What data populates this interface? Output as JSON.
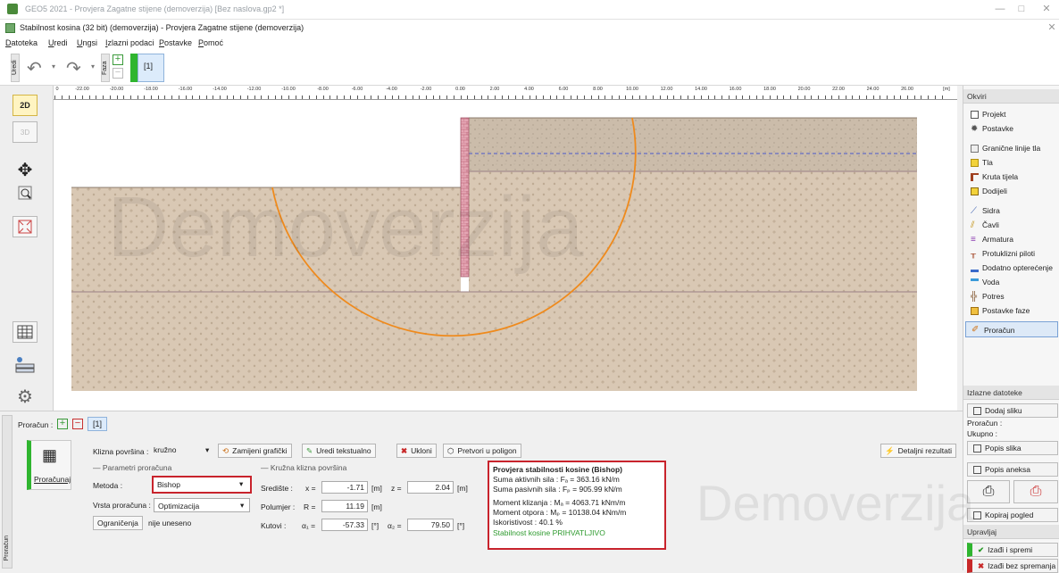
{
  "window": {
    "title": "GEO5 2021 - Provjera Zagatne stijene (demoverzija) [Bez naslova.gp2 *]",
    "subtitle": "Stabilnost kosina (32 bit) (demoverzija) - Provjera Zagatne stijene (demoverzija)",
    "min": "—",
    "max": "□",
    "close": "✕",
    "close2": "✕"
  },
  "menu": [
    "Datoteka",
    "Uredi",
    "Ungsi",
    "Izlazni podaci",
    "Postavke",
    "Pomoć"
  ],
  "toolbar": {
    "uredi": "Uredi",
    "faza": "Faza",
    "stage": "[1]",
    "plus": "+",
    "minus": "−"
  },
  "ruler": {
    "ticks": [
      "-22.00",
      "-20.00",
      "-18.00",
      "-16.00",
      "-14.00",
      "-12.00",
      "-10.00",
      "-8.00",
      "-6.00",
      "-4.00",
      "-2.00",
      "0.00",
      "2.00",
      "4.00",
      "6.00",
      "8.00",
      "10.00",
      "12.00",
      "14.00",
      "16.00",
      "18.00",
      "20.00",
      "22.00",
      "24.00",
      "26.00"
    ],
    "unit": "[m]",
    "zero": "0"
  },
  "leftbar": {
    "b2d": "2D",
    "b3d": "3D"
  },
  "watermark": "Demoverzija",
  "watermark2": "Demoverzija",
  "right": {
    "okviri": "Okviri",
    "items1": [
      "Projekt",
      "Postavke"
    ],
    "items2": [
      "Granične linije tla",
      "Tla",
      "Kruta tijela",
      "Dodijeli"
    ],
    "items3": [
      "Sidra",
      "Čavli",
      "Armatura",
      "Protuklizni piloti",
      "Dodatno opterećenje",
      "Voda",
      "Potres",
      "Postavke faze"
    ],
    "proracun": "Proračun",
    "izlazne": "Izlazne datoteke",
    "dodaj": "Dodaj sliku",
    "proracun_lbl": "Proračun :",
    "ukupno_lbl": "Ukupno :",
    "popis_slika": "Popis slika",
    "popis_aneksa": "Popis aneksa",
    "kopiraj": "Kopiraj pogled",
    "upravljaj": "Upravljaj",
    "izadi": "Izađi i spremi",
    "izadi_bez": "Izađi bez spremanja"
  },
  "bottom": {
    "proracun_lbl": "Proračun :",
    "stage": "[1]",
    "side_tab": "Proračun",
    "run_btn": "Proračunaj",
    "klizna_lbl": "Klizna površina :",
    "klizna_val": "kružno",
    "zamijeni": "Zamijeni grafički",
    "uredi_tekst": "Uredi tekstualno",
    "ukloni": "Ukloni",
    "pretvori": "Pretvori u poligon",
    "detaljni": "Detaljni rezultati",
    "params_title": "Parametri proračuna",
    "metoda_lbl": "Metoda :",
    "metoda_val": "Bishop",
    "vrsta_lbl": "Vrsta proračuna :",
    "vrsta_val": "Optimizacija",
    "ogr_btn": "Ograničenja",
    "ogr_val": "nije uneseno",
    "krug_title": "Kružna klizna površina",
    "srediste_lbl": "Središte :",
    "x_lbl": "x =",
    "x_val": "-1.71",
    "m1": "[m]",
    "z_lbl": "z =",
    "z_val": "2.04",
    "m2": "[m]",
    "polumjer_lbl": "Polumjer :",
    "r_lbl": "R =",
    "r_val": "11.19",
    "m3": "[m]",
    "kutovi_lbl": "Kutovi :",
    "a1_lbl": "α₁ =",
    "a1_val": "-57.33",
    "deg1": "[°]",
    "a2_lbl": "α₂ =",
    "a2_val": "79.50",
    "deg2": "[°]"
  },
  "results": {
    "title": "Provjera stabilnosti kosine (Bishop)",
    "lines": [
      "Suma aktivnih sila :   Fₐ =    363.16  kN/m",
      "Suma pasivnih sila :  Fₚ =    905.99  kN/m",
      "Moment klizanja :     Mₐ =   4063.71  kNm/m",
      "Moment otpora :       Mₚ =  10138.04  kNm/m",
      "Iskoristivost : 40.1  %"
    ],
    "status": "Stabilnost kosine PRIHVATLJIVO",
    "status_color": "#2e9a2e"
  }
}
